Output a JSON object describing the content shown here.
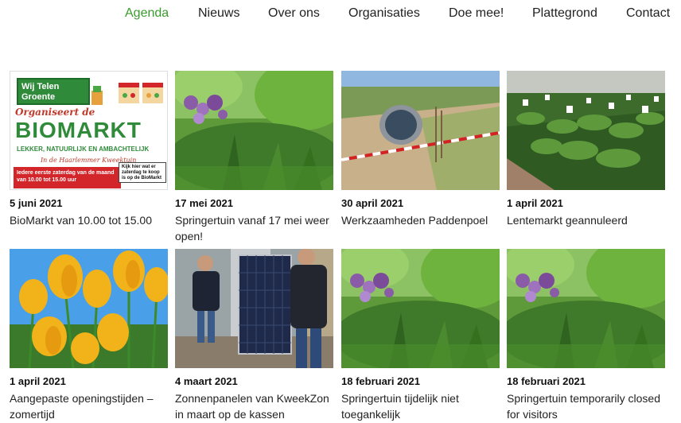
{
  "nav": {
    "items": [
      {
        "label": "Agenda",
        "active": true
      },
      {
        "label": "Nieuws",
        "active": false
      },
      {
        "label": "Over ons",
        "active": false
      },
      {
        "label": "Organisaties",
        "active": false
      },
      {
        "label": "Doe mee!",
        "active": false
      },
      {
        "label": "Plattegrond",
        "active": false
      },
      {
        "label": "Contact",
        "active": false
      }
    ],
    "active_color": "#3a9b2e"
  },
  "biomarkt_poster": {
    "brand": "Wij Telen Groente",
    "organiseert": "Organiseert de",
    "headline": "BIOMARKT",
    "tagline": "LEKKER, NATUURLIJK EN AMBACHTELIJK",
    "location": "In de Haarlemmer Kweektuin",
    "schedule": "Iedere eerste zaterdag van de maand van 10.00 tot 15.00 uur",
    "note": "Kijk hier wat er zaterdag te koop is op de BioMarkt"
  },
  "posts": [
    {
      "date": "5 juni 2021",
      "title": "BioMarkt van 10.00 tot 15.00",
      "image": "biomarkt-poster"
    },
    {
      "date": "17 mei 2021",
      "title": "Springertuin vanaf 17 mei weer open!",
      "image": "garden"
    },
    {
      "date": "30 april 2021",
      "title": "Werkzaamheden Paddenpoel",
      "image": "construction"
    },
    {
      "date": "1 april 2021",
      "title": "Lentemarkt geannuleerd",
      "image": "greenhouse-plants"
    },
    {
      "date": "1 april 2021",
      "title": "Aangepaste openingstijden – zomertijd",
      "image": "tulips"
    },
    {
      "date": "4 maart 2021",
      "title": "Zonnenpanelen van KweekZon in maart op de kassen",
      "image": "solar-panel"
    },
    {
      "date": "18 februari 2021",
      "title": "Springertuin tijdelijk niet toegankelijk",
      "image": "garden"
    },
    {
      "date": "18 februari 2021",
      "title": "Springertuin temporarily closed for visitors",
      "image": "garden"
    }
  ]
}
